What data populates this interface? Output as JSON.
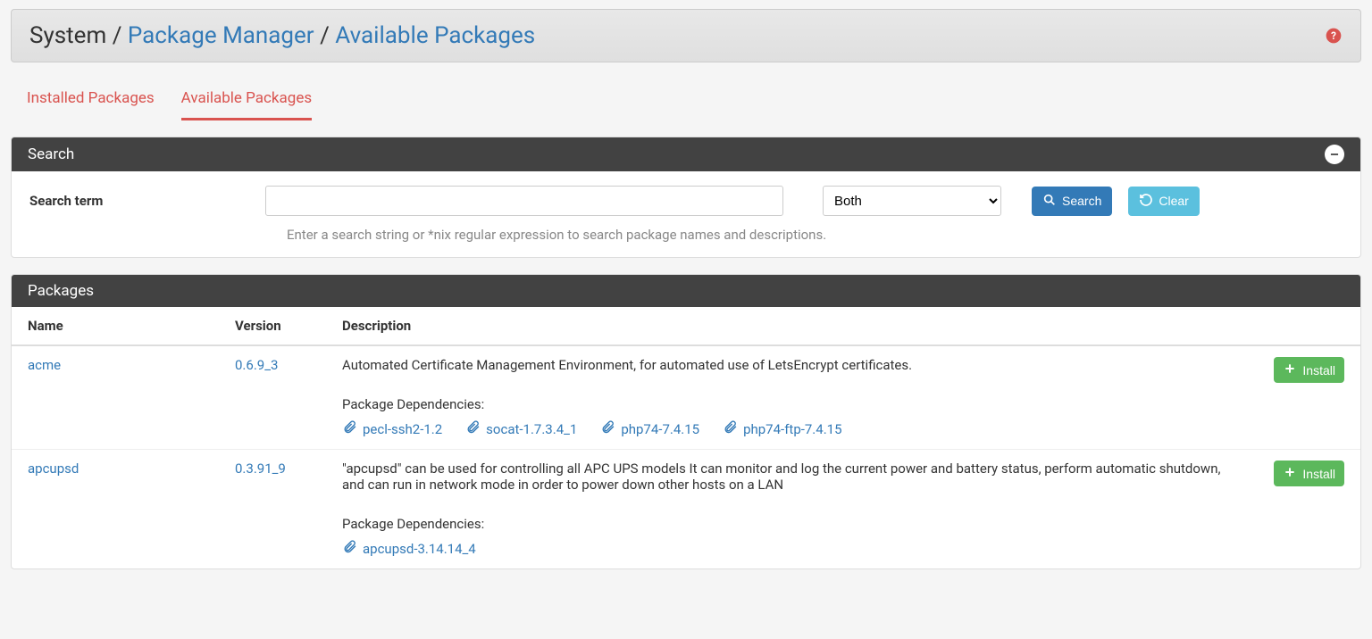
{
  "breadcrumb": {
    "root": "System",
    "mid": "Package Manager",
    "leaf": "Available Packages"
  },
  "tabs": {
    "installed": "Installed Packages",
    "available": "Available Packages"
  },
  "search_panel": {
    "title": "Search",
    "label": "Search term",
    "value": "",
    "select_value": "Both",
    "search_btn": "Search",
    "clear_btn": "Clear",
    "help_text": "Enter a search string or *nix regular expression to search package names and descriptions."
  },
  "packages_panel": {
    "title": "Packages",
    "columns": {
      "name": "Name",
      "version": "Version",
      "description": "Description"
    },
    "install_btn": "Install",
    "dep_label": "Package Dependencies:",
    "rows": [
      {
        "name": "acme",
        "version": "0.6.9_3",
        "description": "Automated Certificate Management Environment, for automated use of LetsEncrypt certificates.",
        "deps": [
          "pecl-ssh2-1.2",
          "socat-1.7.3.4_1",
          "php74-7.4.15",
          "php74-ftp-7.4.15"
        ]
      },
      {
        "name": "apcupsd",
        "version": "0.3.91_9",
        "description": "\"apcupsd\" can be used for controlling all APC UPS models It can monitor and log the current power and battery status, perform automatic shutdown, and can run in network mode in order to power down other hosts on a LAN",
        "deps": [
          "apcupsd-3.14.14_4"
        ]
      }
    ]
  }
}
